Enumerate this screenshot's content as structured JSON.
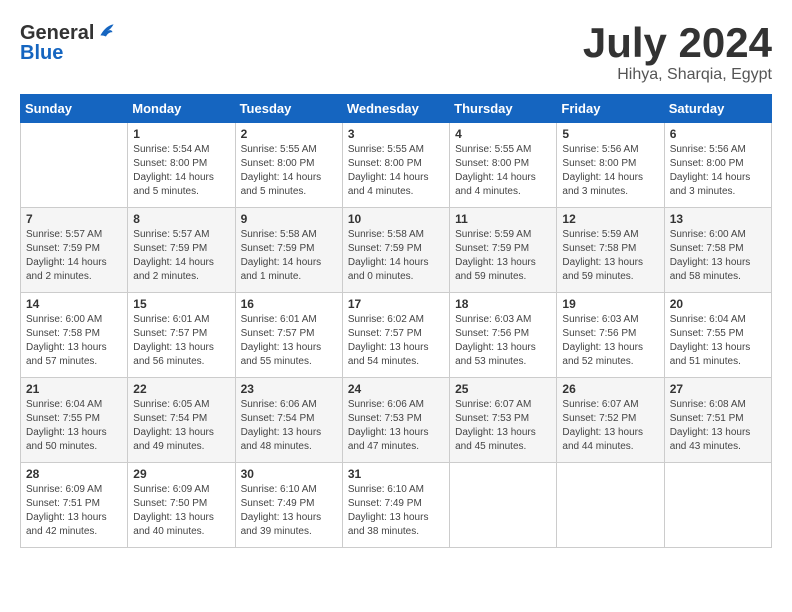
{
  "header": {
    "logo_general": "General",
    "logo_blue": "Blue",
    "month": "July 2024",
    "location": "Hihya, Sharqia, Egypt"
  },
  "weekdays": [
    "Sunday",
    "Monday",
    "Tuesday",
    "Wednesday",
    "Thursday",
    "Friday",
    "Saturday"
  ],
  "weeks": [
    [
      {
        "day": "",
        "sunrise": "",
        "sunset": "",
        "daylight": ""
      },
      {
        "day": "1",
        "sunrise": "Sunrise: 5:54 AM",
        "sunset": "Sunset: 8:00 PM",
        "daylight": "Daylight: 14 hours and 5 minutes."
      },
      {
        "day": "2",
        "sunrise": "Sunrise: 5:55 AM",
        "sunset": "Sunset: 8:00 PM",
        "daylight": "Daylight: 14 hours and 5 minutes."
      },
      {
        "day": "3",
        "sunrise": "Sunrise: 5:55 AM",
        "sunset": "Sunset: 8:00 PM",
        "daylight": "Daylight: 14 hours and 4 minutes."
      },
      {
        "day": "4",
        "sunrise": "Sunrise: 5:55 AM",
        "sunset": "Sunset: 8:00 PM",
        "daylight": "Daylight: 14 hours and 4 minutes."
      },
      {
        "day": "5",
        "sunrise": "Sunrise: 5:56 AM",
        "sunset": "Sunset: 8:00 PM",
        "daylight": "Daylight: 14 hours and 3 minutes."
      },
      {
        "day": "6",
        "sunrise": "Sunrise: 5:56 AM",
        "sunset": "Sunset: 8:00 PM",
        "daylight": "Daylight: 14 hours and 3 minutes."
      }
    ],
    [
      {
        "day": "7",
        "sunrise": "Sunrise: 5:57 AM",
        "sunset": "Sunset: 7:59 PM",
        "daylight": "Daylight: 14 hours and 2 minutes."
      },
      {
        "day": "8",
        "sunrise": "Sunrise: 5:57 AM",
        "sunset": "Sunset: 7:59 PM",
        "daylight": "Daylight: 14 hours and 2 minutes."
      },
      {
        "day": "9",
        "sunrise": "Sunrise: 5:58 AM",
        "sunset": "Sunset: 7:59 PM",
        "daylight": "Daylight: 14 hours and 1 minute."
      },
      {
        "day": "10",
        "sunrise": "Sunrise: 5:58 AM",
        "sunset": "Sunset: 7:59 PM",
        "daylight": "Daylight: 14 hours and 0 minutes."
      },
      {
        "day": "11",
        "sunrise": "Sunrise: 5:59 AM",
        "sunset": "Sunset: 7:59 PM",
        "daylight": "Daylight: 13 hours and 59 minutes."
      },
      {
        "day": "12",
        "sunrise": "Sunrise: 5:59 AM",
        "sunset": "Sunset: 7:58 PM",
        "daylight": "Daylight: 13 hours and 59 minutes."
      },
      {
        "day": "13",
        "sunrise": "Sunrise: 6:00 AM",
        "sunset": "Sunset: 7:58 PM",
        "daylight": "Daylight: 13 hours and 58 minutes."
      }
    ],
    [
      {
        "day": "14",
        "sunrise": "Sunrise: 6:00 AM",
        "sunset": "Sunset: 7:58 PM",
        "daylight": "Daylight: 13 hours and 57 minutes."
      },
      {
        "day": "15",
        "sunrise": "Sunrise: 6:01 AM",
        "sunset": "Sunset: 7:57 PM",
        "daylight": "Daylight: 13 hours and 56 minutes."
      },
      {
        "day": "16",
        "sunrise": "Sunrise: 6:01 AM",
        "sunset": "Sunset: 7:57 PM",
        "daylight": "Daylight: 13 hours and 55 minutes."
      },
      {
        "day": "17",
        "sunrise": "Sunrise: 6:02 AM",
        "sunset": "Sunset: 7:57 PM",
        "daylight": "Daylight: 13 hours and 54 minutes."
      },
      {
        "day": "18",
        "sunrise": "Sunrise: 6:03 AM",
        "sunset": "Sunset: 7:56 PM",
        "daylight": "Daylight: 13 hours and 53 minutes."
      },
      {
        "day": "19",
        "sunrise": "Sunrise: 6:03 AM",
        "sunset": "Sunset: 7:56 PM",
        "daylight": "Daylight: 13 hours and 52 minutes."
      },
      {
        "day": "20",
        "sunrise": "Sunrise: 6:04 AM",
        "sunset": "Sunset: 7:55 PM",
        "daylight": "Daylight: 13 hours and 51 minutes."
      }
    ],
    [
      {
        "day": "21",
        "sunrise": "Sunrise: 6:04 AM",
        "sunset": "Sunset: 7:55 PM",
        "daylight": "Daylight: 13 hours and 50 minutes."
      },
      {
        "day": "22",
        "sunrise": "Sunrise: 6:05 AM",
        "sunset": "Sunset: 7:54 PM",
        "daylight": "Daylight: 13 hours and 49 minutes."
      },
      {
        "day": "23",
        "sunrise": "Sunrise: 6:06 AM",
        "sunset": "Sunset: 7:54 PM",
        "daylight": "Daylight: 13 hours and 48 minutes."
      },
      {
        "day": "24",
        "sunrise": "Sunrise: 6:06 AM",
        "sunset": "Sunset: 7:53 PM",
        "daylight": "Daylight: 13 hours and 47 minutes."
      },
      {
        "day": "25",
        "sunrise": "Sunrise: 6:07 AM",
        "sunset": "Sunset: 7:53 PM",
        "daylight": "Daylight: 13 hours and 45 minutes."
      },
      {
        "day": "26",
        "sunrise": "Sunrise: 6:07 AM",
        "sunset": "Sunset: 7:52 PM",
        "daylight": "Daylight: 13 hours and 44 minutes."
      },
      {
        "day": "27",
        "sunrise": "Sunrise: 6:08 AM",
        "sunset": "Sunset: 7:51 PM",
        "daylight": "Daylight: 13 hours and 43 minutes."
      }
    ],
    [
      {
        "day": "28",
        "sunrise": "Sunrise: 6:09 AM",
        "sunset": "Sunset: 7:51 PM",
        "daylight": "Daylight: 13 hours and 42 minutes."
      },
      {
        "day": "29",
        "sunrise": "Sunrise: 6:09 AM",
        "sunset": "Sunset: 7:50 PM",
        "daylight": "Daylight: 13 hours and 40 minutes."
      },
      {
        "day": "30",
        "sunrise": "Sunrise: 6:10 AM",
        "sunset": "Sunset: 7:49 PM",
        "daylight": "Daylight: 13 hours and 39 minutes."
      },
      {
        "day": "31",
        "sunrise": "Sunrise: 6:10 AM",
        "sunset": "Sunset: 7:49 PM",
        "daylight": "Daylight: 13 hours and 38 minutes."
      },
      {
        "day": "",
        "sunrise": "",
        "sunset": "",
        "daylight": ""
      },
      {
        "day": "",
        "sunrise": "",
        "sunset": "",
        "daylight": ""
      },
      {
        "day": "",
        "sunrise": "",
        "sunset": "",
        "daylight": ""
      }
    ]
  ]
}
